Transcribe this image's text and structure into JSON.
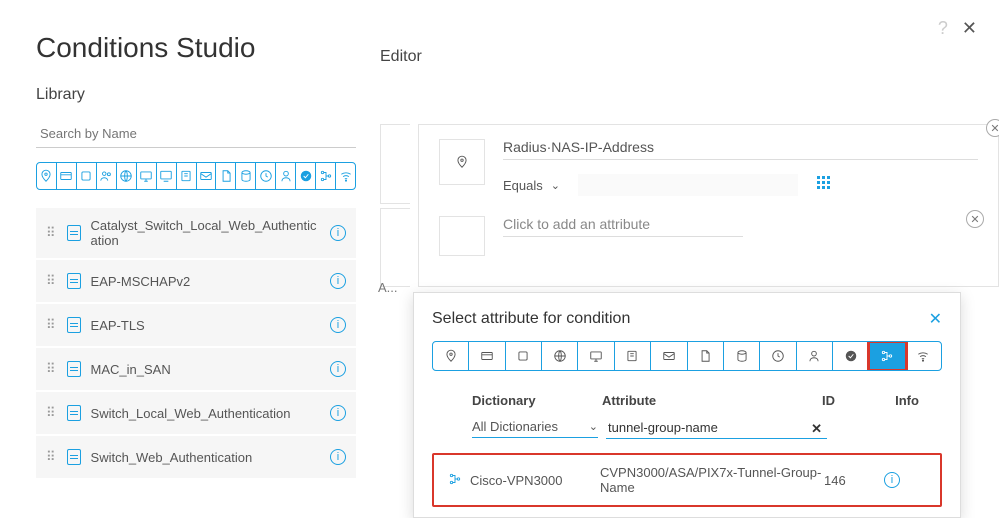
{
  "page": {
    "title": "Conditions Studio"
  },
  "library": {
    "heading": "Library",
    "search_placeholder": "Search by Name",
    "items": [
      {
        "label": "Catalyst_Switch_Local_Web_Authentication"
      },
      {
        "label": "EAP-MSCHAPv2"
      },
      {
        "label": "EAP-TLS"
      },
      {
        "label": "MAC_in_SAN"
      },
      {
        "label": "Switch_Local_Web_Authentication"
      },
      {
        "label": "Switch_Web_Authentication"
      }
    ]
  },
  "editor": {
    "heading": "Editor",
    "condition1": {
      "attribute": "Radius·NAS-IP-Address",
      "operator": "Equals"
    },
    "condition2": {
      "placeholder": "Click to add an attribute"
    },
    "connector": "A..."
  },
  "popup": {
    "title": "Select attribute for condition",
    "columns": {
      "dict": "Dictionary",
      "attr": "Attribute",
      "id": "ID",
      "info": "Info"
    },
    "dict_dropdown": "All Dictionaries",
    "attr_search": "tunnel-group-name",
    "result": {
      "dictionary": "Cisco-VPN3000",
      "attribute": "CVPN3000/ASA/PIX7x-Tunnel-Group-Name",
      "id": "146"
    }
  }
}
